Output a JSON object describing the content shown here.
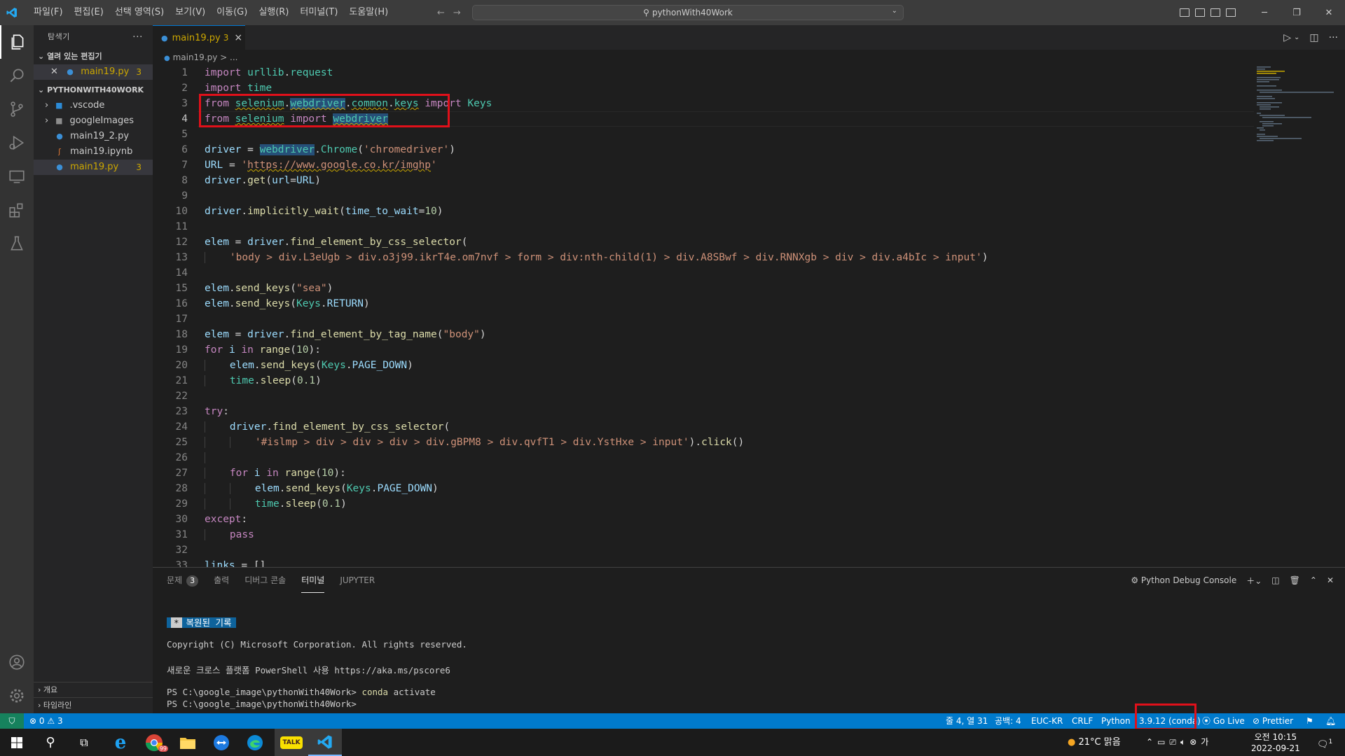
{
  "titlebar": {
    "menus": [
      "파일(F)",
      "편집(E)",
      "선택 영역(S)",
      "보기(V)",
      "이동(G)",
      "실행(R)",
      "터미널(T)",
      "도움말(H)"
    ],
    "search": "pythonWith40Work"
  },
  "sidebar": {
    "title": "탐색기",
    "more": "···",
    "open_editors_label": "열려 있는 편집기",
    "open_editor_file": "main19.py",
    "open_editor_badge": "3",
    "workspace_label": "PYTHONWITH40WORK",
    "tree": [
      {
        "name": ".vscode",
        "badge": ""
      },
      {
        "name": "googleImages",
        "badge": ""
      },
      {
        "name": "main19_2.py",
        "badge": ""
      },
      {
        "name": "main19.ipynb",
        "badge": ""
      },
      {
        "name": "main19.py",
        "badge": "3"
      }
    ],
    "outline_label": "개요",
    "timeline_label": "타임라인"
  },
  "tab": {
    "name": "main19.py",
    "badge": "3",
    "close": "×"
  },
  "breadcrumb": "main19.py > ...",
  "editor": {
    "line_numbers": [
      "1",
      "2",
      "3",
      "4",
      "5",
      "6",
      "7",
      "8",
      "9",
      "10",
      "11",
      "12",
      "13",
      "14",
      "15",
      "16",
      "17",
      "18",
      "19",
      "20",
      "21",
      "22",
      "23",
      "24",
      "25",
      "26",
      "27",
      "28",
      "29",
      "30",
      "31",
      "32",
      "33"
    ]
  },
  "panel": {
    "tabs": [
      "문제",
      "출력",
      "디버그 콘솔",
      "터미널",
      "JUPYTER"
    ],
    "problems_count": "3",
    "terminal_name": "Python Debug Console",
    "restored_star": "*",
    "restored_label": "복원된 기록",
    "copyright": "Copyright (C) Microsoft Corporation. All rights reserved.",
    "powershell": "새로운 크로스 플랫폼 PowerShell 사용 https://aka.ms/pscore6",
    "prompt1": "PS C:\\google_image\\pythonWith40Work> ",
    "cmd1": "conda",
    "cmd1_arg": " activate",
    "prompt2": "PS C:\\google_image\\pythonWith40Work> "
  },
  "statusbar": {
    "errors": "0",
    "warnings": "3",
    "position": "줄 4, 열 31",
    "spaces": "공백: 4",
    "encoding": "EUC-KR",
    "eol": "CRLF",
    "language": "Python",
    "interpreter": "3.9.12 (conda)",
    "golive": "Go Live",
    "prettier": "Prettier"
  },
  "taskbar": {
    "weather": "21°C  맑음",
    "time": "오전 10:15",
    "date": "2022-09-21",
    "chrome_badge": "99",
    "notif": "1"
  },
  "colors": {
    "accent": "#007acc",
    "highlight_box": "#e0101a"
  }
}
